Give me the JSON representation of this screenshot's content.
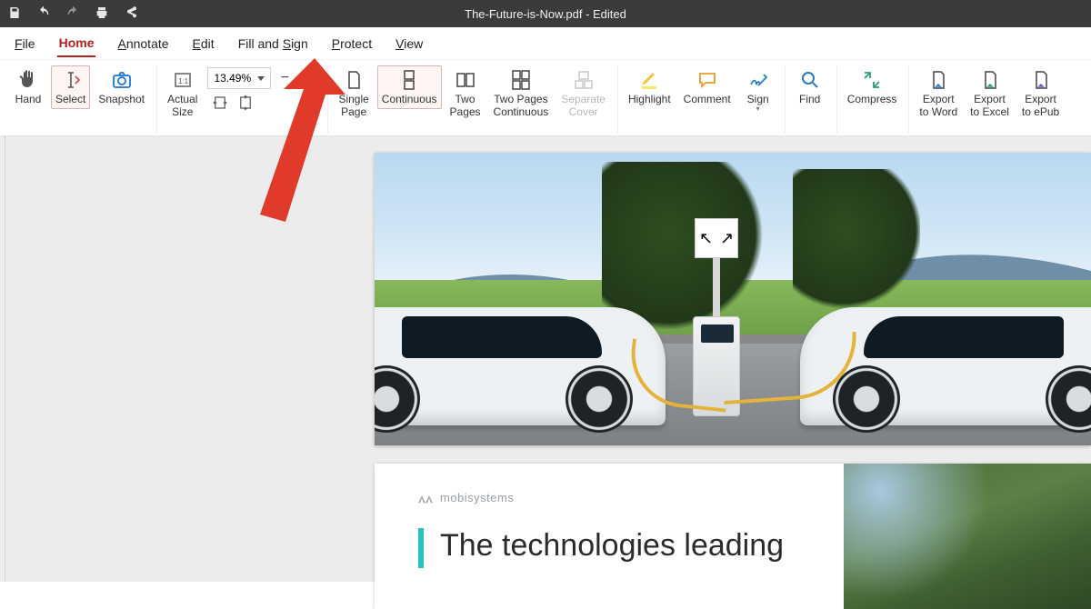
{
  "title": "The-Future-is-Now.pdf - Edited",
  "quick_access": {
    "save": "save-icon",
    "undo": "undo-icon",
    "redo": "redo-icon",
    "print": "print-icon",
    "share": "share-icon"
  },
  "menubar": {
    "file": "File",
    "home": "Home",
    "annotate": "Annotate",
    "edit": "Edit",
    "fill_and_sign": "Fill and Sign",
    "protect": "Protect",
    "view": "View",
    "active": "home"
  },
  "ribbon": {
    "hand": "Hand",
    "select": "Select",
    "snapshot": "Snapshot",
    "actual_size": "Actual\nSize",
    "zoom_value": "13.49%",
    "single_page": "Single\nPage",
    "continuous": "Continuous",
    "two_pages": "Two\nPages",
    "two_pages_continuous": "Two Pages\nContinuous",
    "separate_cover": "Separate\nCover",
    "highlight": "Highlight",
    "comment": "Comment",
    "sign": "Sign",
    "find": "Find",
    "compress": "Compress",
    "export_word": "Export\nto Word",
    "export_excel": "Export\nto Excel",
    "export_epub": "Export\nto ePub"
  },
  "document": {
    "brand": "mobisystems",
    "headline": "The technologies leading",
    "charger_sign_left": "↖",
    "charger_sign_right": "↗"
  },
  "annotation": {
    "arrow_color": "#e03a2a"
  }
}
